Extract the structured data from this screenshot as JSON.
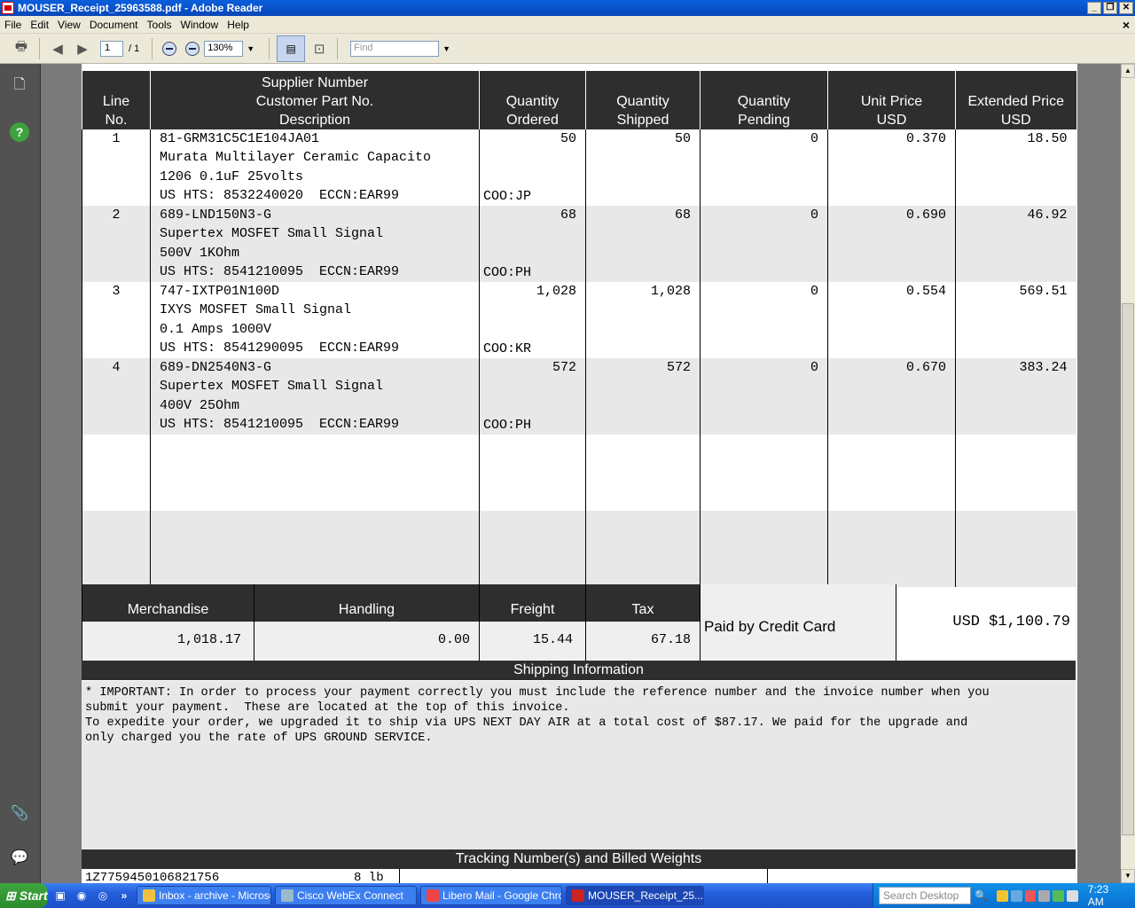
{
  "window": {
    "title": "MOUSER_Receipt_25963588.pdf - Adobe Reader"
  },
  "menu": [
    "File",
    "Edit",
    "View",
    "Document",
    "Tools",
    "Window",
    "Help"
  ],
  "toolbar": {
    "page_current": "1",
    "page_total": "/ 1",
    "zoom": "130%",
    "find_placeholder": "Find"
  },
  "table": {
    "headers": {
      "line": [
        "Line",
        "No."
      ],
      "desc": [
        "Supplier Number",
        "Customer Part No.",
        "Description"
      ],
      "ordered": [
        "Quantity",
        "Ordered"
      ],
      "shipped": [
        "Quantity",
        "Shipped"
      ],
      "pending": [
        "Quantity",
        "Pending"
      ],
      "unit": [
        "Unit Price",
        "USD"
      ],
      "ext": [
        "Extended Price",
        "USD"
      ]
    },
    "rows": [
      {
        "line": "1",
        "part": "81-GRM31C5C1E104JA01",
        "desc1": "Murata Multilayer Ceramic Capacito",
        "desc2": "1206 0.1uF 25volts",
        "hts": "US HTS: 8532240020  ECCN:EAR99",
        "coo": "COO:JP",
        "ordered": "50",
        "shipped": "50",
        "pending": "0",
        "unit": "0.370",
        "ext": "18.50"
      },
      {
        "line": "2",
        "part": "689-LND150N3-G",
        "desc1": "Supertex MOSFET Small Signal",
        "desc2": "500V 1KOhm",
        "hts": "US HTS: 8541210095  ECCN:EAR99",
        "coo": "COO:PH",
        "ordered": "68",
        "shipped": "68",
        "pending": "0",
        "unit": "0.690",
        "ext": "46.92"
      },
      {
        "line": "3",
        "part": "747-IXTP01N100D",
        "desc1": "IXYS MOSFET Small Signal",
        "desc2": "0.1 Amps 1000V",
        "hts": "US HTS: 8541290095  ECCN:EAR99",
        "coo": "COO:KR",
        "ordered": "1,028",
        "shipped": "1,028",
        "pending": "0",
        "unit": "0.554",
        "ext": "569.51"
      },
      {
        "line": "4",
        "part": "689-DN2540N3-G",
        "desc1": "Supertex MOSFET Small Signal",
        "desc2": "400V 25Ohm",
        "hts": "US HTS: 8541210095  ECCN:EAR99",
        "coo": "COO:PH",
        "ordered": "572",
        "shipped": "572",
        "pending": "0",
        "unit": "0.670",
        "ext": "383.24"
      }
    ]
  },
  "totals": {
    "merch_label": "Merchandise",
    "merch": "1,018.17",
    "handling_label": "Handling",
    "handling": "0.00",
    "freight_label": "Freight",
    "freight": "15.44",
    "tax_label": "Tax",
    "tax": "67.18",
    "paid_by": "Paid by Credit Card",
    "grand_total": "USD $1,100.79"
  },
  "shipping": {
    "header": "Shipping Information",
    "note": "* IMPORTANT: In order to process your payment correctly you must include the reference number and the invoice number when you\nsubmit your payment.  These are located at the top of this invoice.\nTo expedite your order, we upgraded it to ship via UPS NEXT DAY AIR at a total cost of $87.17. We paid for the upgrade and\nonly charged you the rate of UPS GROUND SERVICE."
  },
  "tracking": {
    "header": "Tracking Number(s) and Billed Weights",
    "number": "1Z7759450106821756",
    "weight": "8 lb"
  },
  "taskbar": {
    "start": "Start",
    "tasks": [
      "Inbox - archive - Microso...",
      "Cisco WebEx Connect",
      "Libero Mail - Google Chro...",
      "MOUSER_Receipt_25..."
    ],
    "search_placeholder": "Search Desktop",
    "clock": "7:23 AM"
  }
}
